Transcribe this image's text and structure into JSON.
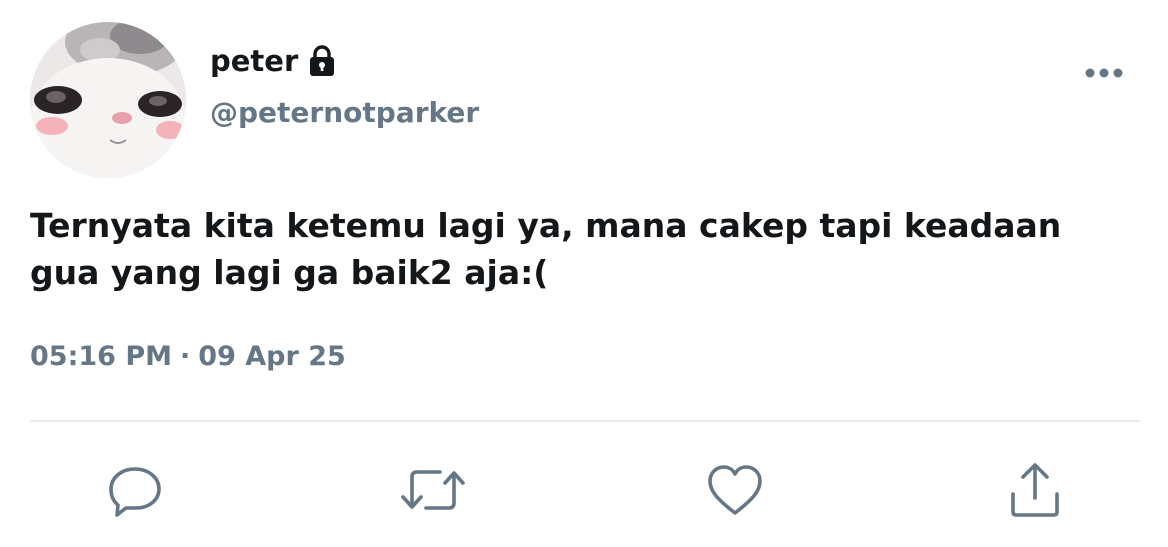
{
  "user": {
    "display_name": "peter",
    "handle": "@peternotparker",
    "protected_icon": "lock-icon",
    "avatar": "cat-face-avatar"
  },
  "tweet": {
    "text": "Ternyata kita ketemu lagi ya, mana cakep tapi keadaan\ngua yang lagi ga baik2 aja:(",
    "time": "05:16 PM",
    "separator": "·",
    "date": "09 Apr 25"
  },
  "actions": [
    {
      "icon": "reply-icon"
    },
    {
      "icon": "retweet-icon"
    },
    {
      "icon": "like-icon"
    },
    {
      "icon": "share-icon"
    }
  ],
  "menu_icon": "more-options-icon",
  "colors": {
    "text_primary": "#14171a",
    "text_secondary": "#657786",
    "icon": "#657786",
    "divider": "#e6ecf0"
  }
}
